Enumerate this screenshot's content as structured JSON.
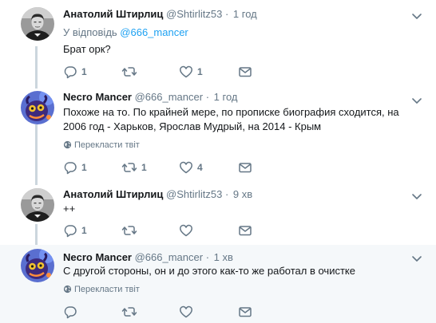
{
  "tweets": [
    {
      "author": "Анатолий Штирлиц",
      "handle": "@Shtirlitz53",
      "time": "1 год",
      "reply_prefix": "У відповідь ",
      "reply_mention": "@666_mancer",
      "text": "Брат орк?",
      "reply_count": "1",
      "retweet_count": "",
      "like_count": "1",
      "translate": "",
      "avatar": "avatar-bw-man"
    },
    {
      "author": "Necro Mancer",
      "handle": "@666_mancer",
      "time": "1 год",
      "text": "Похоже на то. По крайней мере, по прописке биография сходится, на 2006 год - Харьков, Ярослав Мудрый, на 2014 - Крым",
      "reply_count": "1",
      "retweet_count": "1",
      "like_count": "4",
      "translate": "Перекласти твіт",
      "avatar": "avatar-creature"
    },
    {
      "author": "Анатолий Штирлиц",
      "handle": "@Shtirlitz53",
      "time": "9 хв",
      "text": "++",
      "reply_count": "1",
      "retweet_count": "",
      "like_count": "",
      "translate": "",
      "avatar": "avatar-bw-man"
    },
    {
      "author": "Necro Mancer",
      "handle": "@666_mancer",
      "time": "1 хв",
      "text": "С другой стороны, он и до этого как-то же работал в очистке",
      "reply_count": "",
      "retweet_count": "",
      "like_count": "",
      "translate": "Перекласти твіт",
      "avatar": "avatar-creature"
    }
  ],
  "dot": "·",
  "colors": {
    "text": "#14171a",
    "secondary": "#657786",
    "link": "#1da1f2",
    "thread_line": "#ccd6dd",
    "highlight_bg": "#f5f8fa"
  },
  "icons": [
    "chevron-down-icon",
    "reply-icon",
    "retweet-icon",
    "like-icon",
    "direct-message-icon",
    "globe-icon"
  ]
}
